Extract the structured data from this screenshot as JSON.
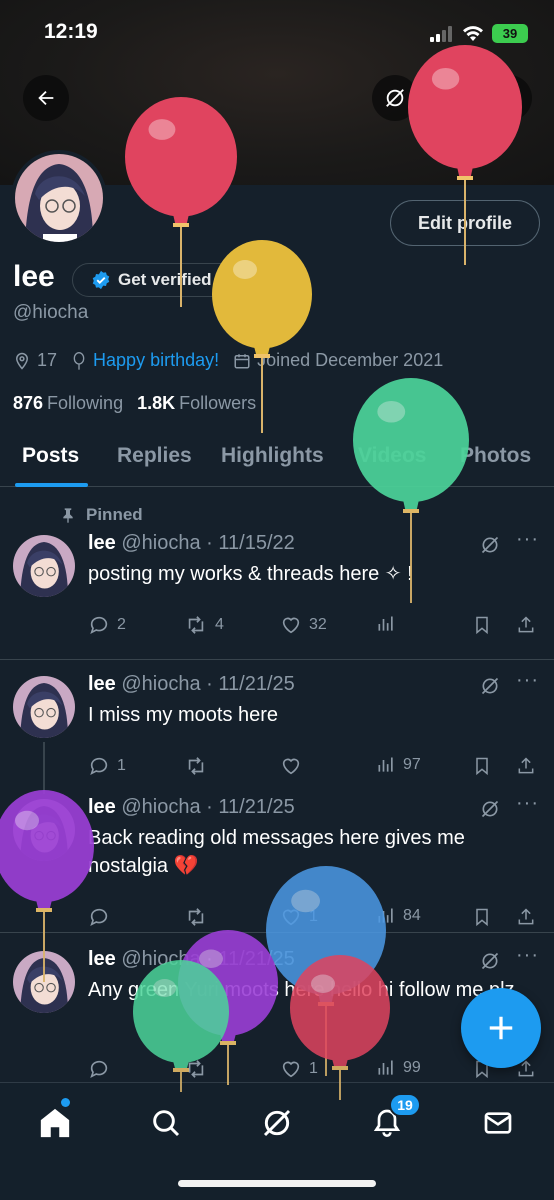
{
  "status_bar": {
    "time": "12:19",
    "battery": "39"
  },
  "profile": {
    "name": "lee",
    "get_verified_label": "Get verified",
    "handle": "@hiocha",
    "edit_profile_label": "Edit profile",
    "location": "17",
    "birthday": "Happy birthday!",
    "joined": "Joined December 2021",
    "following_count": "876",
    "following_label": "Following",
    "followers_count": "1.8K",
    "followers_label": "Followers"
  },
  "tabs": [
    "Posts",
    "Replies",
    "Highlights",
    "Videos",
    "Photos"
  ],
  "pinned_label": "Pinned",
  "posts": [
    {
      "name": "lee",
      "meta": "@hiocha · 11/15/22",
      "text": "posting my works & threads here ✧ !",
      "replies": "2",
      "reposts": "4",
      "likes": "32",
      "views": ""
    },
    {
      "name": "lee",
      "meta": "@hiocha · 11/21/25",
      "text": "I miss my moots here",
      "replies": "1",
      "reposts": "",
      "likes": "",
      "views": "97"
    },
    {
      "name": "lee",
      "meta": "@hiocha · 11/21/25",
      "text": "Back reading old messages here gives me nostalgia 💔",
      "replies": "",
      "reposts": "",
      "likes": "1",
      "views": "84"
    },
    {
      "name": "lee",
      "meta": "@hiocha · 11/21/25",
      "text": "Any green Yuri moots here hello hi follow me plz",
      "replies": "",
      "reposts": "",
      "likes": "1",
      "views": "99"
    }
  ],
  "notifications_badge": "19",
  "icons": {
    "back": "arrow-left-icon",
    "grok": "grok-icon",
    "search": "search-icon",
    "share": "share-icon",
    "location": "location-pin-icon",
    "birthday": "balloon-icon",
    "calendar": "calendar-icon",
    "pin": "pin-icon",
    "reply": "reply-icon",
    "repost": "repost-icon",
    "like": "heart-icon",
    "views": "views-icon",
    "bookmark": "bookmark-icon",
    "compose": "plus-icon",
    "nav": [
      "home-icon",
      "search-icon",
      "grok-icon",
      "bell-icon",
      "mail-icon"
    ]
  },
  "colors": {
    "accent": "#1d9bf0",
    "background": "#15202b",
    "muted": "#8b98a5",
    "border": "#38444d"
  }
}
